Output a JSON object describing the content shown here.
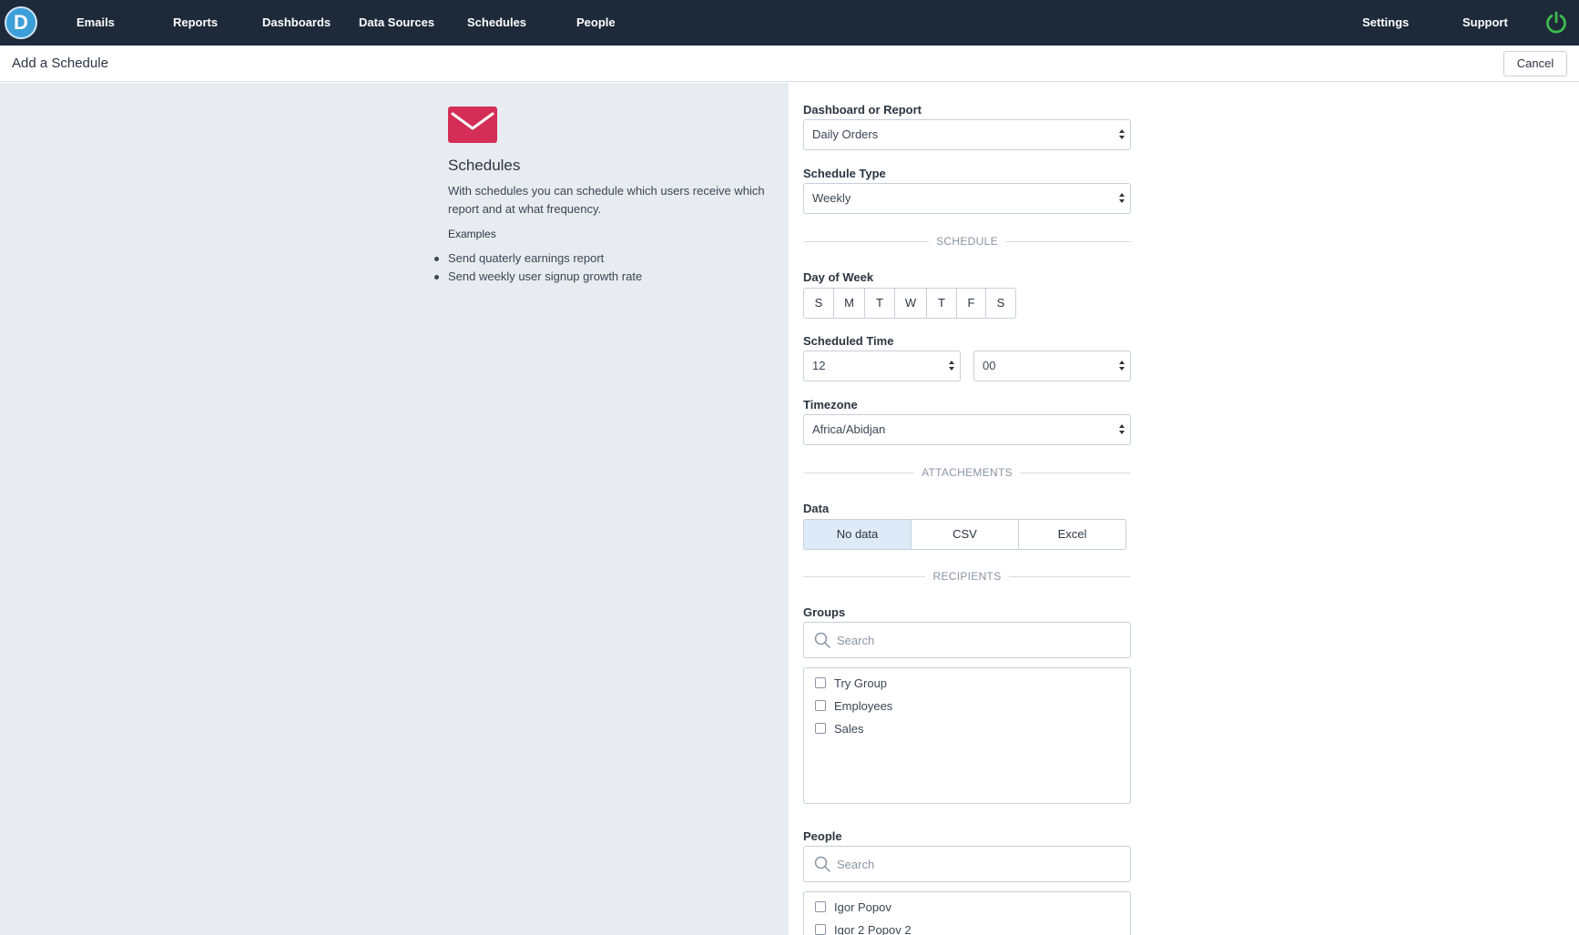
{
  "nav": {
    "logo_letter": "D",
    "items": [
      "Emails",
      "Reports",
      "Dashboards",
      "Data Sources",
      "Schedules",
      "People"
    ],
    "right_items": [
      "Settings",
      "Support"
    ]
  },
  "header": {
    "title": "Add a Schedule",
    "cancel_label": "Cancel"
  },
  "info": {
    "title": "Schedules",
    "description": "With schedules you can schedule which users receive which report and at what frequency.",
    "examples_label": "Examples",
    "examples": [
      "Send quaterly earnings report",
      "Send weekly user signup growth rate"
    ]
  },
  "form": {
    "report_label": "Dashboard or Report",
    "report_value": "Daily Orders",
    "type_label": "Schedule Type",
    "type_value": "Weekly",
    "schedule_section": "SCHEDULE",
    "day_label": "Day of Week",
    "days": [
      "S",
      "M",
      "T",
      "W",
      "T",
      "F",
      "S"
    ],
    "time_label": "Scheduled Time",
    "hour_value": "12",
    "minute_value": "00",
    "timezone_label": "Timezone",
    "timezone_value": "Africa/Abidjan",
    "attachments_section": "ATTACHEMENTS",
    "data_label": "Data",
    "data_options": [
      "No data",
      "CSV",
      "Excel"
    ],
    "data_selected": "No data",
    "recipients_section": "RECIPIENTS",
    "groups_label": "Groups",
    "groups_search_placeholder": "Search",
    "groups": [
      "Try Group",
      "Employees",
      "Sales"
    ],
    "people_label": "People",
    "people_search_placeholder": "Search",
    "people": [
      "Igor Popov",
      "Igor 2 Popov 2"
    ]
  },
  "colors": {
    "nav_bg": "#1e2a3a",
    "logo_bg": "#3d9fd8",
    "mail_icon": "#d42e56",
    "power_icon": "#3dbb4e",
    "left_pane_bg": "#e8ecf0",
    "selected_option_bg": "#dcebf7"
  },
  "icons": {
    "logo": "d-logo-icon",
    "power": "power-icon",
    "mail": "envelope-icon",
    "search": "search-icon"
  }
}
